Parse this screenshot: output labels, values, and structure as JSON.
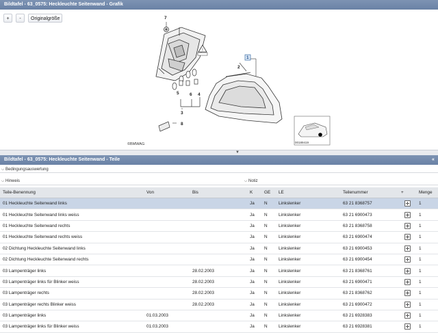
{
  "graphic_panel": {
    "title": "Bildtafel - 63_0575: Heckleuchte Seitenwand - Grafik",
    "toolbar": {
      "zoom_in": "+",
      "zoom_out": "-",
      "original_size": "Originalgröße"
    },
    "callouts": [
      "7",
      "1",
      "2",
      "5",
      "6",
      "4",
      "3",
      "8"
    ],
    "copyright": "©BMWAG",
    "thumbnail_code": "00189419"
  },
  "parts_panel": {
    "title": "Bildtafel - 63_0575: Heckleuchte Seitenwand - Teile",
    "collapse_icon": "«",
    "conditions_label": "Bedingungsauswertung",
    "hints_label": "Hinweis",
    "notes_label": "Notiz",
    "columns": [
      "Teile-Benennung",
      "Von",
      "Bis",
      "K",
      "GE",
      "LE",
      "Teilenummer",
      "+",
      "Menge"
    ],
    "rows": [
      {
        "name": "01 Heckleuchte Seitenwand links",
        "from": "",
        "to": "",
        "k": "Ja",
        "ge": "N",
        "le": "Linkslenker",
        "part": "63 21 8368757",
        "qty": "1"
      },
      {
        "name": "01 Heckleuchte Seitenwand links weiss",
        "from": "",
        "to": "",
        "k": "Ja",
        "ge": "N",
        "le": "Linkslenker",
        "part": "63 21 6900473",
        "qty": "1"
      },
      {
        "name": "01 Heckleuchte Seitenwand rechts",
        "from": "",
        "to": "",
        "k": "Ja",
        "ge": "N",
        "le": "Linkslenker",
        "part": "63 21 8368758",
        "qty": "1"
      },
      {
        "name": "01 Heckleuchte Seitenwand rechts weiss",
        "from": "",
        "to": "",
        "k": "Ja",
        "ge": "N",
        "le": "Linkslenker",
        "part": "63 21 6900474",
        "qty": "1"
      },
      {
        "name": "02 Dichtung Heckleuchte Seitenwand links",
        "from": "",
        "to": "",
        "k": "Ja",
        "ge": "N",
        "le": "Linkslenker",
        "part": "63 21 6900453",
        "qty": "1"
      },
      {
        "name": "02 Dichtung Heckleuchte Seitenwand rechts",
        "from": "",
        "to": "",
        "k": "Ja",
        "ge": "N",
        "le": "Linkslenker",
        "part": "63 21 6900454",
        "qty": "1"
      },
      {
        "name": "03 Lampenträger links",
        "from": "",
        "to": "28.02.2003",
        "k": "Ja",
        "ge": "N",
        "le": "Linkslenker",
        "part": "63 21 8368761",
        "qty": "1"
      },
      {
        "name": "03 Lampenträger links für Blinker weiss",
        "from": "",
        "to": "28.02.2003",
        "k": "Ja",
        "ge": "N",
        "le": "Linkslenker",
        "part": "63 21 6900471",
        "qty": "1"
      },
      {
        "name": "03 Lampenträger rechts",
        "from": "",
        "to": "28.02.2003",
        "k": "Ja",
        "ge": "N",
        "le": "Linkslenker",
        "part": "63 21 8368762",
        "qty": "1"
      },
      {
        "name": "03 Lampenträger rechts Blinker weiss",
        "from": "",
        "to": "28.02.2003",
        "k": "Ja",
        "ge": "N",
        "le": "Linkslenker",
        "part": "63 21 6900472",
        "qty": "1"
      },
      {
        "name": "03 Lampenträger links",
        "from": "01.03.2003",
        "to": "",
        "k": "Ja",
        "ge": "N",
        "le": "Linkslenker",
        "part": "63 21 6928383",
        "qty": "1"
      },
      {
        "name": "03 Lampenträger links für Blinker weiss",
        "from": "01.03.2003",
        "to": "",
        "k": "Ja",
        "ge": "N",
        "le": "Linkslenker",
        "part": "63 21 6928381",
        "qty": "1"
      }
    ]
  }
}
